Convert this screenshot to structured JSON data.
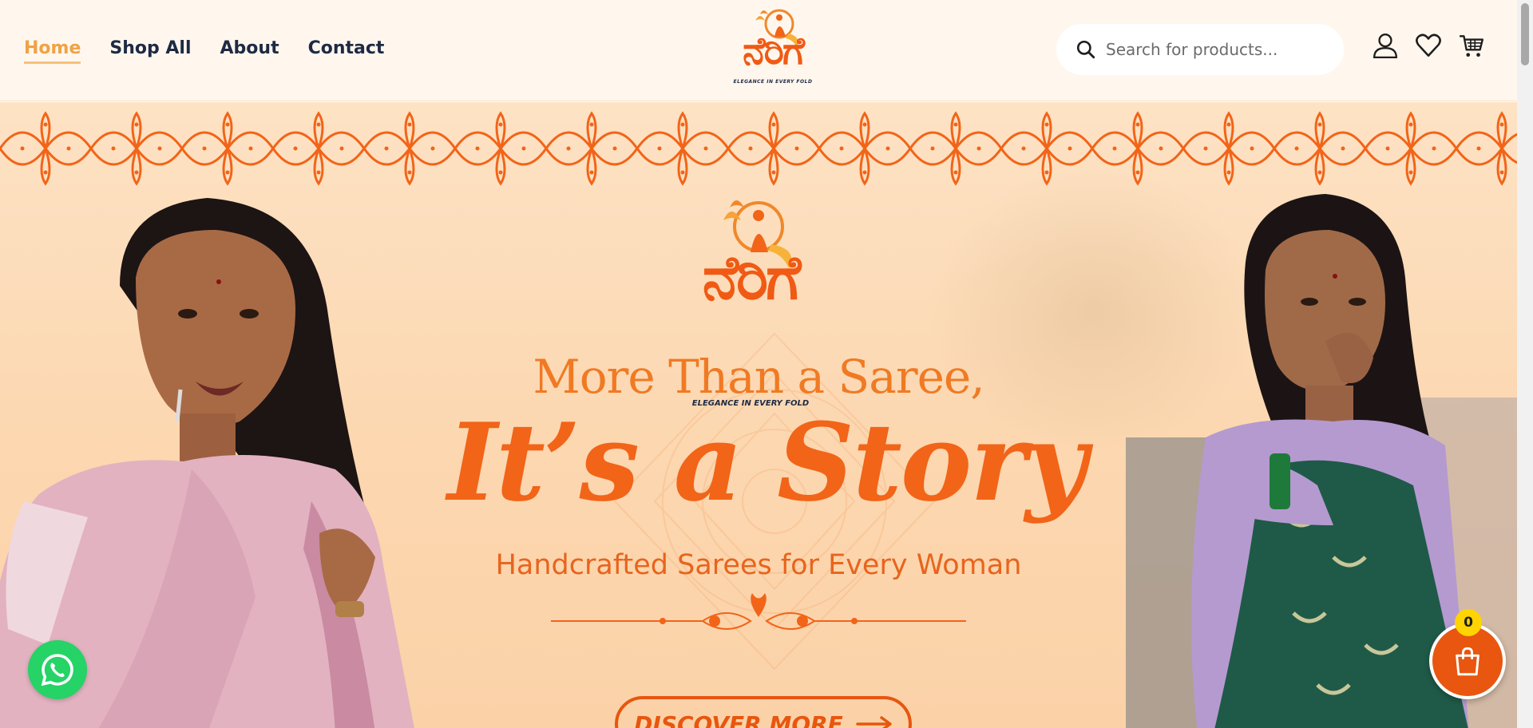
{
  "header": {
    "nav": [
      {
        "label": "Home",
        "active": true
      },
      {
        "label": "Shop All",
        "active": false
      },
      {
        "label": "About",
        "active": false
      },
      {
        "label": "Contact",
        "active": false
      }
    ],
    "logo": {
      "text": "ನೆರಿಗೆ",
      "tagline": "ELEGANCE IN EVERY FOLD"
    },
    "search": {
      "placeholder": "Search for products...",
      "value": "",
      "icon": "search-icon"
    },
    "icons": [
      "user-icon",
      "heart-icon",
      "cart-icon"
    ]
  },
  "hero": {
    "logo": {
      "text": "ನೆರಿಗೆ",
      "tagline": "ELEGANCE IN EVERY FOLD"
    },
    "headline_1": "More Than a Saree,",
    "headline_2": "It’s a Story",
    "subline": "Handcrafted Sarees for Every Woman",
    "cta_label": "DISCOVER MORE"
  },
  "floating": {
    "whatsapp_icon": "whatsapp-icon",
    "cart_count": "0",
    "cart_icon": "shopping-bag-icon"
  },
  "colors": {
    "accent": "#f26418",
    "nav_active": "#f0a243",
    "nav_text": "#1e2a44",
    "hero_bg": "#fcd7b0",
    "header_bg": "#fff7ee",
    "whatsapp": "#25d366",
    "badge": "#ffd400"
  }
}
